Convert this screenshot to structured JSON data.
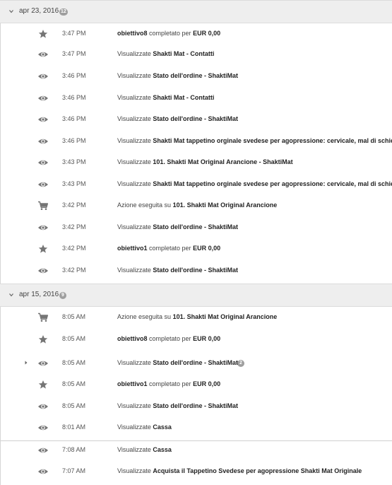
{
  "colors": {
    "icon": "#757575",
    "header_bg": "#eeeeee",
    "badge": "#9e9e9e"
  },
  "groups": [
    {
      "date": "apr 23, 2016",
      "count": "12",
      "rows": [
        {
          "icon": "star-icon",
          "time": "3:47 PM",
          "bold1": "obiettivo8",
          "mid": " completato per ",
          "bold2": "EUR 0,00"
        },
        {
          "icon": "eye-icon",
          "time": "3:47 PM",
          "prefix": "Visualizzate ",
          "bold1": "Shakti Mat - Contatti"
        },
        {
          "icon": "eye-icon",
          "time": "3:46 PM",
          "prefix": "Visualizzate ",
          "bold1": "Stato dell'ordine - ShaktiMat"
        },
        {
          "icon": "eye-icon",
          "time": "3:46 PM",
          "prefix": "Visualizzate ",
          "bold1": "Shakti Mat - Contatti"
        },
        {
          "icon": "eye-icon",
          "time": "3:46 PM",
          "prefix": "Visualizzate ",
          "bold1": "Stato dell'ordine - ShaktiMat"
        },
        {
          "icon": "eye-icon",
          "time": "3:46 PM",
          "prefix": "Visualizzate ",
          "bold1": "Shakti Mat tappetino orginale svedese per agopressione: cervicale, mal di schiena"
        },
        {
          "icon": "eye-icon",
          "time": "3:43 PM",
          "prefix": "Visualizzate ",
          "bold1": "101. Shakti Mat Original Arancione - ShaktiMat"
        },
        {
          "icon": "eye-icon",
          "time": "3:43 PM",
          "prefix": "Visualizzate ",
          "bold1": "Shakti Mat tappetino orginale svedese per agopressione: cervicale, mal di schiena"
        },
        {
          "icon": "cart-icon",
          "time": "3:42 PM",
          "prefix": "Azione eseguita su ",
          "bold1": "101. Shakti Mat Original Arancione"
        },
        {
          "icon": "eye-icon",
          "time": "3:42 PM",
          "prefix": "Visualizzate ",
          "bold1": "Stato dell'ordine - ShaktiMat"
        },
        {
          "icon": "star-icon",
          "time": "3:42 PM",
          "bold1": "obiettivo1",
          "mid": " completato per ",
          "bold2": "EUR 0,00"
        },
        {
          "icon": "eye-icon",
          "time": "3:42 PM",
          "prefix": "Visualizzate ",
          "bold1": "Stato dell'ordine - ShaktiMat"
        }
      ]
    },
    {
      "date": "apr 15, 2016",
      "count": "9",
      "rows": [
        {
          "icon": "cart-icon",
          "time": "8:05 AM",
          "prefix": "Azione eseguita su ",
          "bold1": "101. Shakti Mat Original Arancione"
        },
        {
          "icon": "star-icon",
          "time": "8:05 AM",
          "bold1": "obiettivo8",
          "mid": " completato per ",
          "bold2": "EUR 0,00"
        },
        {
          "icon": "eye-icon",
          "time": "8:05 AM",
          "prefix": "Visualizzate ",
          "bold1": "Stato dell'ordine - ShaktiMat",
          "badge": "2"
        },
        {
          "icon": "star-icon",
          "time": "8:05 AM",
          "bold1": "obiettivo1",
          "mid": " completato per ",
          "bold2": "EUR 0,00"
        },
        {
          "icon": "eye-icon",
          "time": "8:05 AM",
          "prefix": "Visualizzate ",
          "bold1": "Stato dell'ordine - ShaktiMat"
        },
        {
          "icon": "eye-icon",
          "time": "8:01 AM",
          "prefix": "Visualizzate ",
          "bold1": "Cassa"
        },
        {
          "icon": "eye-icon",
          "time": "7:08 AM",
          "prefix": "Visualizzate ",
          "bold1": "Cassa"
        },
        {
          "icon": "eye-icon",
          "time": "7:07 AM",
          "prefix": "Visualizzate ",
          "bold1": "Acquista il Tappetino Svedese per agopressione Shakti Mat Originale"
        }
      ]
    }
  ]
}
